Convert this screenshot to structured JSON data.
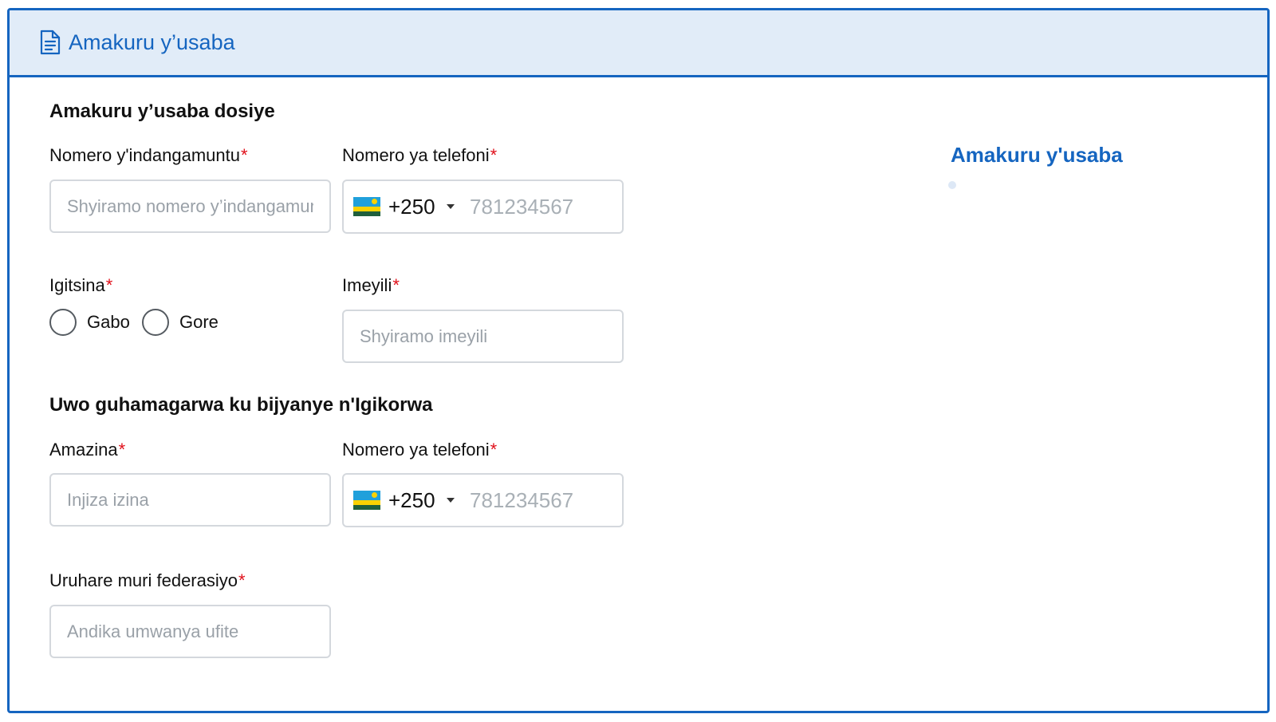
{
  "header": {
    "title": "Amakuru y’usaba",
    "icon": "document-icon"
  },
  "applicant_section": {
    "title": "Amakuru y’usaba dosiye",
    "id_number": {
      "label": "Nomero y'indangamuntu",
      "required_mark": "*",
      "placeholder": "Shyiramo nomero y’indangamuntu",
      "value": ""
    },
    "phone": {
      "label": "Nomero ya telefoni",
      "required_mark": "*",
      "country_flag": "rwanda-flag-icon",
      "dial_code": "+250",
      "placeholder": "781234567",
      "value": ""
    },
    "gender": {
      "label": "Igitsina",
      "required_mark": "*",
      "options": [
        "Gabo",
        "Gore"
      ],
      "selected": null
    },
    "email": {
      "label": "Imeyili",
      "required_mark": "*",
      "placeholder": "Shyiramo imeyili",
      "value": ""
    }
  },
  "contact_section": {
    "title": "Uwo guhamagarwa ku bijyanye n'Igikorwa",
    "name": {
      "label": "Amazina",
      "required_mark": "*",
      "placeholder": "Injiza izina",
      "value": ""
    },
    "phone": {
      "label": "Nomero ya telefoni",
      "required_mark": "*",
      "country_flag": "rwanda-flag-icon",
      "dial_code": "+250",
      "placeholder": "781234567",
      "value": ""
    },
    "role": {
      "label": "Uruhare muri federasiyo",
      "required_mark": "*",
      "placeholder": "Andika umwanya ufite",
      "value": ""
    }
  },
  "side_panel": {
    "title": "Amakuru y'usaba"
  },
  "colors": {
    "accent": "#1565c0",
    "header_bg": "#e1ecf8",
    "required": "#e0101a",
    "input_border": "#d4d8dd",
    "placeholder": "#9aa1a8"
  }
}
